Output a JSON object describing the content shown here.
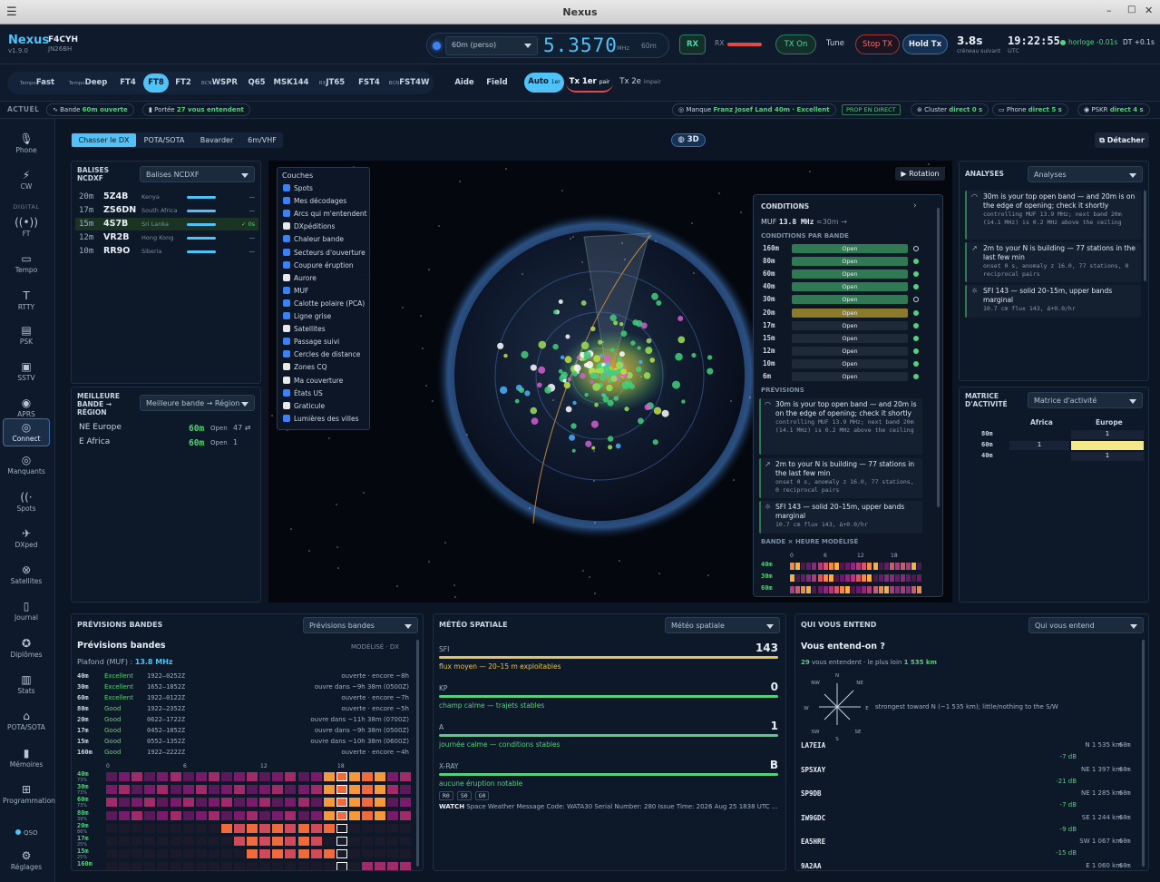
{
  "window": {
    "title": "Nexus"
  },
  "header": {
    "app": "Nexus",
    "version": "v1.9.0",
    "callsign": "F4CYH",
    "locator": "JN26BH",
    "band_select": "60m (perso)",
    "freq": "5.3570",
    "freq_unit": "MHz",
    "band_tag": "60m",
    "rx": "RX",
    "rx_label": "RX",
    "tx_on": "TX On",
    "tune": "Tune",
    "stop_tx": "Stop TX",
    "hold_tx": "Hold Tx",
    "countdown": "3.8s",
    "countdown_sub": "créneau suivant",
    "clock": "19:22:55",
    "clock_sub": "UTC",
    "clock_status": "horloge -0.01s",
    "dt": "DT +0.1s"
  },
  "modes": [
    {
      "pre": "Tempo",
      "label": "Fast"
    },
    {
      "pre": "Tempo",
      "label": "Deep"
    },
    {
      "pre": "",
      "label": "FT4"
    },
    {
      "pre": "",
      "label": "FT8"
    },
    {
      "pre": "",
      "label": "FT2"
    },
    {
      "pre": "BCN",
      "label": "WSPR"
    },
    {
      "pre": "",
      "label": "Q65"
    },
    {
      "pre": "",
      "label": "MSK144"
    },
    {
      "pre": "RX",
      "label": "JT65"
    },
    {
      "pre": "",
      "label": "FST4"
    },
    {
      "pre": "BCN",
      "label": "FST4W"
    }
  ],
  "modebar": {
    "aide": "Aide",
    "field": "Field",
    "auto": "Auto",
    "auto_sub": "1er",
    "tx1": "Tx 1er",
    "tx1_sub": "pair",
    "tx2": "Tx 2e",
    "tx2_sub": "impair"
  },
  "status": {
    "actuel": "ACTUEL",
    "bande_lbl": "Bande",
    "bande_val": "60m ouverte",
    "portee_lbl": "Portée",
    "portee_val": "27 vous entendent",
    "manque_lbl": "Manque",
    "manque_val": "Franz Josef Land 40m · Excellent",
    "prop": "PROP EN DIRECT",
    "cluster_lbl": "Cluster",
    "cluster_val": "direct 0 s",
    "phone_lbl": "Phone",
    "phone_val": "direct 5 s",
    "pskr_lbl": "PSKR",
    "pskr_val": "direct 4 s"
  },
  "sidebar": [
    {
      "icon": "mic",
      "label": "Phone"
    },
    {
      "icon": "bolt",
      "label": "CW"
    },
    {
      "icon": "",
      "label": "DIGITAL"
    },
    {
      "icon": "wave",
      "label": "FT"
    },
    {
      "icon": "chat",
      "label": "Tempo"
    },
    {
      "icon": "T",
      "label": "RTTY"
    },
    {
      "icon": "psk",
      "label": "PSK"
    },
    {
      "icon": "img",
      "label": "SSTV"
    },
    {
      "icon": "pin",
      "label": "APRS"
    },
    {
      "icon": "connect",
      "label": "Connect"
    },
    {
      "icon": "target",
      "label": "Manquants"
    },
    {
      "icon": "spots",
      "label": "Spots"
    },
    {
      "icon": "plane",
      "label": "DXped"
    },
    {
      "icon": "sat",
      "label": "Satellites"
    },
    {
      "icon": "book",
      "label": "Journal"
    },
    {
      "icon": "award",
      "label": "Diplômes"
    },
    {
      "icon": "stats",
      "label": "Stats"
    },
    {
      "icon": "pota",
      "label": "POTA/SOTA"
    },
    {
      "icon": "mem",
      "label": "Mémoires"
    },
    {
      "icon": "prog",
      "label": "Programmation"
    },
    {
      "icon": "qso",
      "label": "QSO"
    },
    {
      "icon": "gear",
      "label": "Réglages"
    }
  ],
  "tabs": {
    "items": [
      "Chasser le DX",
      "POTA/SOTA",
      "Bavarder",
      "6m/VHF"
    ],
    "view3d": "3D",
    "detach": "Détacher"
  },
  "beacons": {
    "title": "BALISES NCDXF",
    "select": "Balises NCDXF",
    "rows": [
      {
        "band": "20m",
        "call": "5Z4B",
        "loc": "Kenya",
        "st": "—"
      },
      {
        "band": "17m",
        "call": "ZS6DN",
        "loc": "South Africa",
        "st": "—"
      },
      {
        "band": "15m",
        "call": "4S7B",
        "loc": "Sri Lanka",
        "st": "✓ 0s"
      },
      {
        "band": "12m",
        "call": "VR2B",
        "loc": "Hong Kong",
        "st": "—"
      },
      {
        "band": "10m",
        "call": "RR9O",
        "loc": "Siberia",
        "st": "—"
      }
    ]
  },
  "bestband": {
    "title": "MEILLEURE BANDE → RÉGION",
    "select": "Meilleure bande → Région",
    "rows": [
      {
        "region": "NE Europe",
        "band": "60m",
        "state": "Open",
        "n": "47 ⇄"
      },
      {
        "region": "E Africa",
        "band": "60m",
        "state": "Open",
        "n": "1"
      }
    ]
  },
  "layers": {
    "title": "Couches",
    "items": [
      {
        "label": "Spots",
        "on": true
      },
      {
        "label": "Mes décodages",
        "on": true
      },
      {
        "label": "Arcs qui m'entendent",
        "on": true
      },
      {
        "label": "DXpéditions",
        "on": false
      },
      {
        "label": "Chaleur bande",
        "on": true
      },
      {
        "label": "Secteurs d'ouverture",
        "on": true
      },
      {
        "label": "Coupure éruption",
        "on": true
      },
      {
        "label": "Aurore",
        "on": false
      },
      {
        "label": "MUF",
        "on": true
      },
      {
        "label": "Calotte polaire (PCA)",
        "on": true
      },
      {
        "label": "Ligne grise",
        "on": true
      },
      {
        "label": "Satellites",
        "on": false
      },
      {
        "label": "Passage suivi",
        "on": true
      },
      {
        "label": "Cercles de distance",
        "on": true
      },
      {
        "label": "Zones CQ",
        "on": false
      },
      {
        "label": "Ma couverture",
        "on": false
      },
      {
        "label": "États US",
        "on": true
      },
      {
        "label": "Graticule",
        "on": false
      },
      {
        "label": "Lumières des villes",
        "on": true
      }
    ]
  },
  "globe": {
    "rotation": "▶ Rotation"
  },
  "conditions": {
    "title": "CONDITIONS",
    "muf_lbl": "MUF",
    "muf_val": "13.8 MHz",
    "muf_sub": "≈30m →",
    "par_bande": "CONDITIONS PAR BANDE",
    "bands": [
      {
        "b": "160m",
        "s": "Open",
        "c": "#2f7a52",
        "dot": "ring"
      },
      {
        "b": "80m",
        "s": "Open",
        "c": "#2f7a52",
        "dot": "g"
      },
      {
        "b": "60m",
        "s": "Open",
        "c": "#2f7a52",
        "dot": "g"
      },
      {
        "b": "40m",
        "s": "Open",
        "c": "#2f7a52",
        "dot": "g"
      },
      {
        "b": "30m",
        "s": "Open",
        "c": "#2f7a52",
        "dot": "ring"
      },
      {
        "b": "20m",
        "s": "Open",
        "c": "#8a7a2a",
        "dot": "g"
      },
      {
        "b": "17m",
        "s": "Open",
        "c": "#1e2a38",
        "dot": "g"
      },
      {
        "b": "15m",
        "s": "Open",
        "c": "#1e2a38",
        "dot": "g"
      },
      {
        "b": "12m",
        "s": "Open",
        "c": "#1e2a38",
        "dot": "g"
      },
      {
        "b": "10m",
        "s": "Open",
        "c": "#1e2a38",
        "dot": "g"
      },
      {
        "b": "6m",
        "s": "Open",
        "c": "#1e2a38",
        "dot": "g"
      }
    ],
    "previsions": "PRÉVISIONS",
    "prev": [
      {
        "t": "30m is your top open band — and 20m is on the edge of opening; check it shortly",
        "d": "controlling MUF 13.9 MHz; next band 20m (14.1 MHz) is 0.2 MHz above the ceiling"
      },
      {
        "t": "2m to your N is building — 77 stations in the last few min",
        "d": "onset 0 s, anomaly z 16.0, 77 stations, 0 reciprocal pairs"
      },
      {
        "t": "SFI 143 — solid 20–15m, upper bands marginal",
        "d": "10.7 cm flux 143, Δ+0.0/hr"
      }
    ],
    "band_hour": "BANDE × HEURE MODÉLISÉ",
    "ticks": [
      "0",
      "6",
      "12",
      "18"
    ],
    "rows": [
      "40m",
      "30m",
      "60m"
    ]
  },
  "analyses": {
    "title": "ANALYSES",
    "select": "Analyses",
    "items": [
      {
        "t": "30m is your top open band — and 20m is on the edge of opening; check it shortly",
        "d": "controlling MUF 13.9 MHz; next band 20m (14.1 MHz) is 0.2 MHz above the ceiling"
      },
      {
        "t": "2m to your N is building — 77 stations in the last few min",
        "d": "onset 0 s, anomaly z 16.0, 77 stations, 0 reciprocal pairs"
      },
      {
        "t": "SFI 143 — solid 20–15m, upper bands marginal",
        "d": "10.7 cm flux 143, Δ+0.0/hr"
      }
    ]
  },
  "matrix": {
    "title": "MATRICE D'ACTIVITÉ",
    "select": "Matrice d'activité",
    "cols": [
      "Africa",
      "Europe"
    ],
    "rows": [
      {
        "b": "80m",
        "a": "",
        "e": "1"
      },
      {
        "b": "60m",
        "a": "1",
        "e": ""
      },
      {
        "b": "40m",
        "a": "",
        "e": "1"
      }
    ]
  },
  "forecast": {
    "title": "PRÉVISIONS BANDES",
    "select": "Prévisions bandes",
    "heading": "Prévisions bandes",
    "model": "MODÉLISÉ · DX",
    "ceiling_lbl": "Plafond (MUF) :",
    "ceiling_val": "13.8 MHz",
    "rows": [
      {
        "b": "40m",
        "q": "Excellent",
        "w": "1922–0252Z",
        "n": "ouverte · encore ~8h"
      },
      {
        "b": "30m",
        "q": "Excellent",
        "w": "1652–1852Z",
        "n": "ouvre dans ~9h 38m (0500Z)"
      },
      {
        "b": "60m",
        "q": "Excellent",
        "w": "1922–0122Z",
        "n": "ouverte · encore ~7h"
      },
      {
        "b": "80m",
        "q": "Good",
        "w": "1922–2352Z",
        "n": "ouverte · encore ~5h"
      },
      {
        "b": "20m",
        "q": "Good",
        "w": "0622–1722Z",
        "n": "ouvre dans ~11h 38m (0700Z)"
      },
      {
        "b": "17m",
        "q": "Good",
        "w": "0452–1052Z",
        "n": "ouvre dans ~9h 38m (0500Z)"
      },
      {
        "b": "15m",
        "q": "Good",
        "w": "0552–1352Z",
        "n": "ouvre dans ~10h 38m (0600Z)"
      },
      {
        "b": "160m",
        "q": "Good",
        "w": "1922–2222Z",
        "n": "ouverte · encore ~4h"
      }
    ],
    "ticks": [
      "0",
      "6",
      "12",
      "18"
    ],
    "hm": [
      {
        "b": "40m",
        "p": "73%"
      },
      {
        "b": "30m",
        "p": "73%"
      },
      {
        "b": "60m",
        "p": "73%"
      },
      {
        "b": "80m",
        "p": "39%"
      },
      {
        "b": "20m",
        "p": "86%"
      },
      {
        "b": "17m",
        "p": "25%"
      },
      {
        "b": "15m",
        "p": "25%"
      },
      {
        "b": "160m",
        "p": ""
      }
    ]
  },
  "weather": {
    "title": "MÉTÉO SPATIALE",
    "select": "Météo spatiale",
    "items": [
      {
        "k": "SFI",
        "v": "143",
        "d": "flux moyen — 20–15 m exploitables",
        "c": "#e8c34a",
        "frac": 1
      },
      {
        "k": "KP",
        "v": "0",
        "d": "champ calme — trajets stables",
        "c": "#54d07e",
        "frac": 1
      },
      {
        "k": "A",
        "v": "1",
        "d": "journée calme — conditions stables",
        "c": "#54d07e",
        "frac": 1
      },
      {
        "k": "X-RAY",
        "v": "B",
        "d": "aucune éruption notable",
        "c": "#54d07e",
        "frac": 1
      }
    ],
    "tags": [
      "R0",
      "S0",
      "G0"
    ],
    "watch_lbl": "WATCH",
    "watch": "Space Weather Message Code: WATA30 Serial Number: 280 Issue Time: 2026 Aug 25 1838 UTC ..."
  },
  "hears": {
    "title": "QUI VOUS ENTEND",
    "select": "Qui vous entend",
    "heading": "Vous entend-on ?",
    "count": "29",
    "count_lbl": "vous entendent · le plus loin",
    "far": "1 535 km",
    "dir_note": "strongest toward N (~1 535 km); little/nothing to the S/W",
    "compass": [
      "N",
      "NE",
      "E",
      "SE",
      "S",
      "SW",
      "W",
      "NW"
    ],
    "rows": [
      {
        "call": "LA7EIA",
        "db": "-7 dB",
        "loc": "N 1 535 km",
        "b": "60m"
      },
      {
        "call": "SP5XAY",
        "db": "-21 dB",
        "loc": "NE 1 397 km",
        "b": "60m"
      },
      {
        "call": "SP9DB",
        "db": "-7 dB",
        "loc": "NE 1 285 km",
        "b": "60m"
      },
      {
        "call": "IW9GDC",
        "db": "-9 dB",
        "loc": "SE 1 244 km",
        "b": "60m"
      },
      {
        "call": "EA5HRE",
        "db": "-15 dB",
        "loc": "SW 1 067 km",
        "b": "60m"
      },
      {
        "call": "9A2AA",
        "db": "",
        "loc": "E 1 060 km",
        "b": "60m"
      }
    ]
  },
  "colors": {
    "accent": "#4fc3f7",
    "green": "#54d07e",
    "bg": "#0b1524"
  }
}
